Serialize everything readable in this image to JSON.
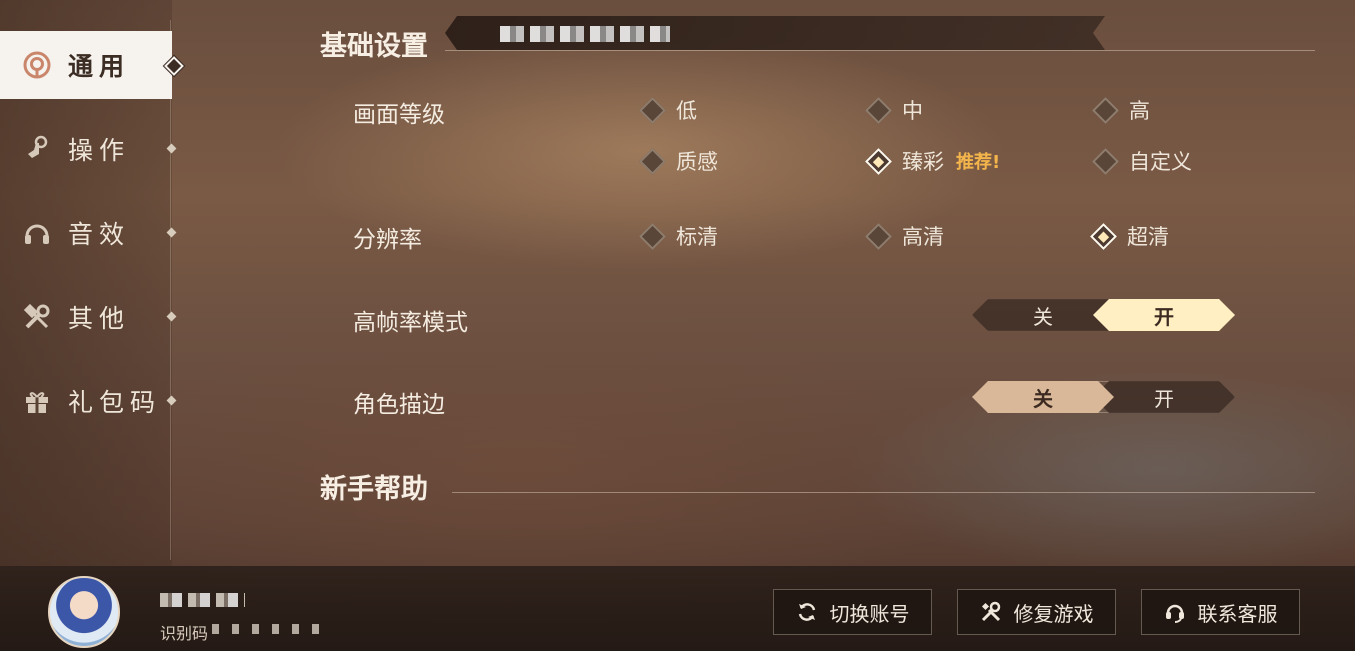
{
  "sidebar": {
    "items": [
      {
        "label": "通用",
        "icon": "general-icon",
        "active": true
      },
      {
        "label": "操作",
        "icon": "touch-icon",
        "active": false
      },
      {
        "label": "音效",
        "icon": "headphone-icon",
        "active": false
      },
      {
        "label": "其他",
        "icon": "tools-icon",
        "active": false
      },
      {
        "label": "礼包码",
        "icon": "gift-icon",
        "active": false
      }
    ]
  },
  "sections": {
    "basic": "基础设置",
    "help": "新手帮助"
  },
  "settings": {
    "graphics": {
      "label": "画面等级",
      "options": [
        "低",
        "中",
        "高",
        "质感",
        "臻彩",
        "自定义"
      ],
      "selected": "臻彩",
      "badge": "推荐!"
    },
    "resolution": {
      "label": "分辨率",
      "options": [
        "标清",
        "高清",
        "超清"
      ],
      "selected": "超清"
    },
    "high_fps": {
      "label": "高帧率模式",
      "off": "关",
      "on": "开",
      "value": "开"
    },
    "outline": {
      "label": "角色描边",
      "off": "关",
      "on": "开",
      "value": "关"
    }
  },
  "footer": {
    "uid_label": "识别码",
    "buttons": {
      "switch_account": "切换账号",
      "repair_game": "修复游戏",
      "contact_support": "联系客服"
    }
  },
  "colors": {
    "toggle_on_primary": "#ffefc2",
    "toggle_on_secondary": "#d8b898",
    "badge": "#f3b54b"
  }
}
